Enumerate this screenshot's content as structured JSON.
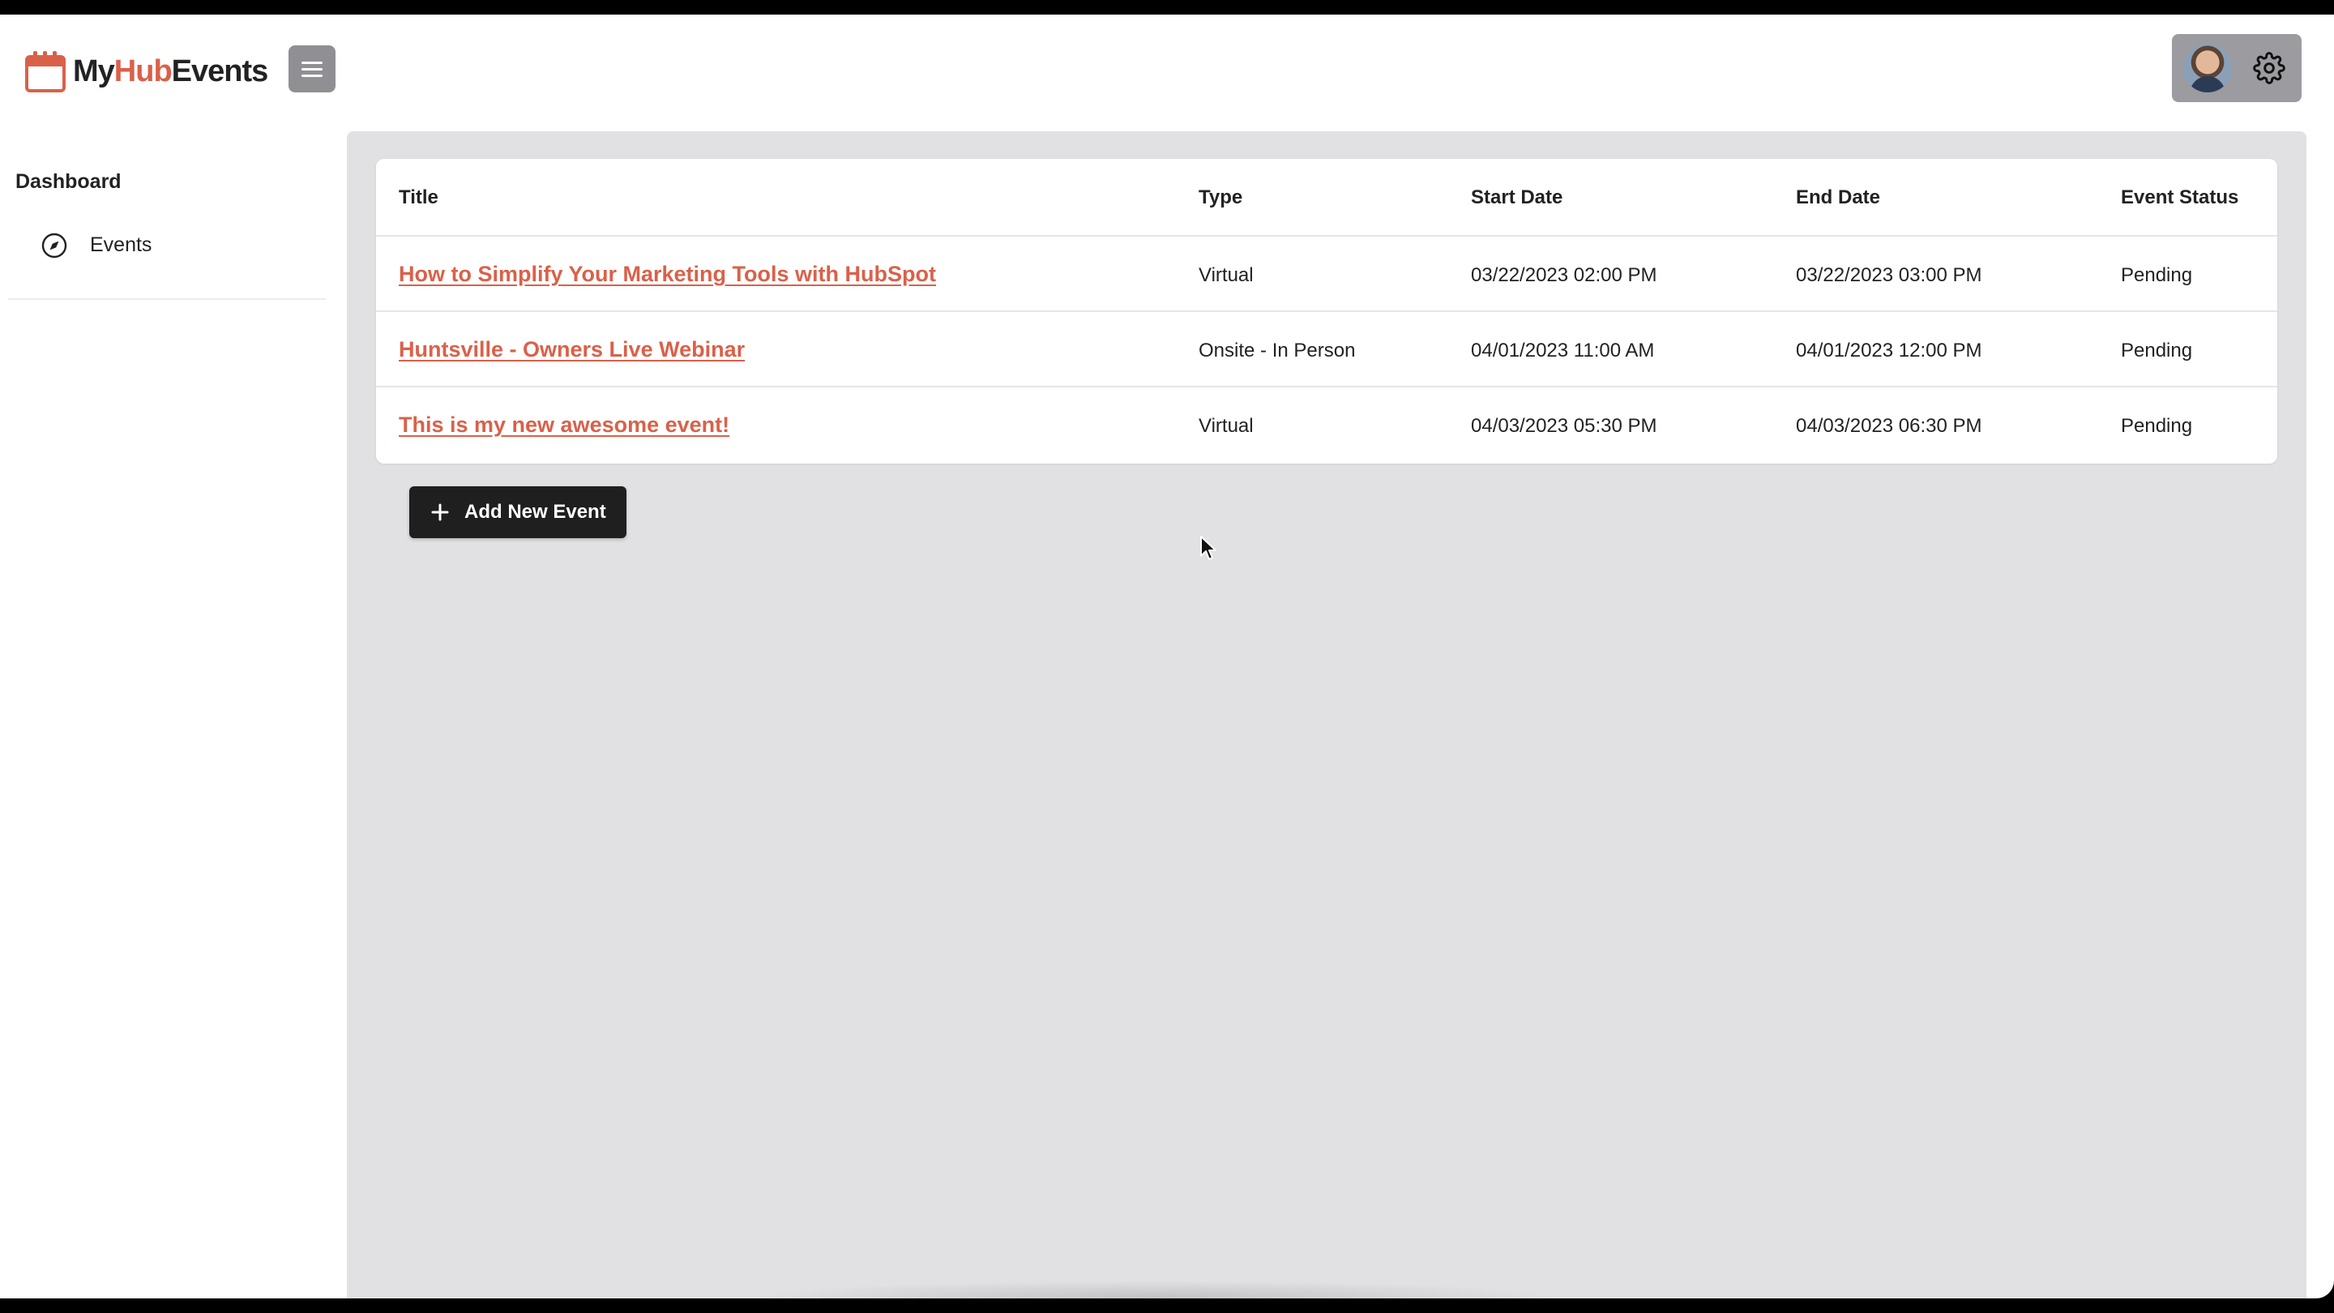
{
  "header": {
    "logo_prefix": "My",
    "logo_accent": "Hub",
    "logo_suffix": "Events",
    "brand_color": "#d9614a"
  },
  "sidebar": {
    "heading": "Dashboard",
    "items": [
      {
        "label": "Events",
        "icon": "compass-icon"
      }
    ]
  },
  "table": {
    "columns": [
      "Title",
      "Type",
      "Start Date",
      "End Date",
      "Event Status"
    ],
    "rows": [
      {
        "title": "How to Simplify Your Marketing Tools with HubSpot",
        "type": "Virtual",
        "start": "03/22/2023 02:00 PM",
        "end": "03/22/2023 03:00 PM",
        "status": "Pending"
      },
      {
        "title": "Huntsville - Owners Live Webinar",
        "type": "Onsite - In Person",
        "start": "04/01/2023 11:00 AM",
        "end": "04/01/2023 12:00 PM",
        "status": "Pending"
      },
      {
        "title": "This is my new awesome event!",
        "type": "Virtual",
        "start": "04/03/2023 05:30 PM",
        "end": "04/03/2023 06:30 PM",
        "status": "Pending"
      }
    ]
  },
  "actions": {
    "add_event_label": "Add New Event"
  }
}
